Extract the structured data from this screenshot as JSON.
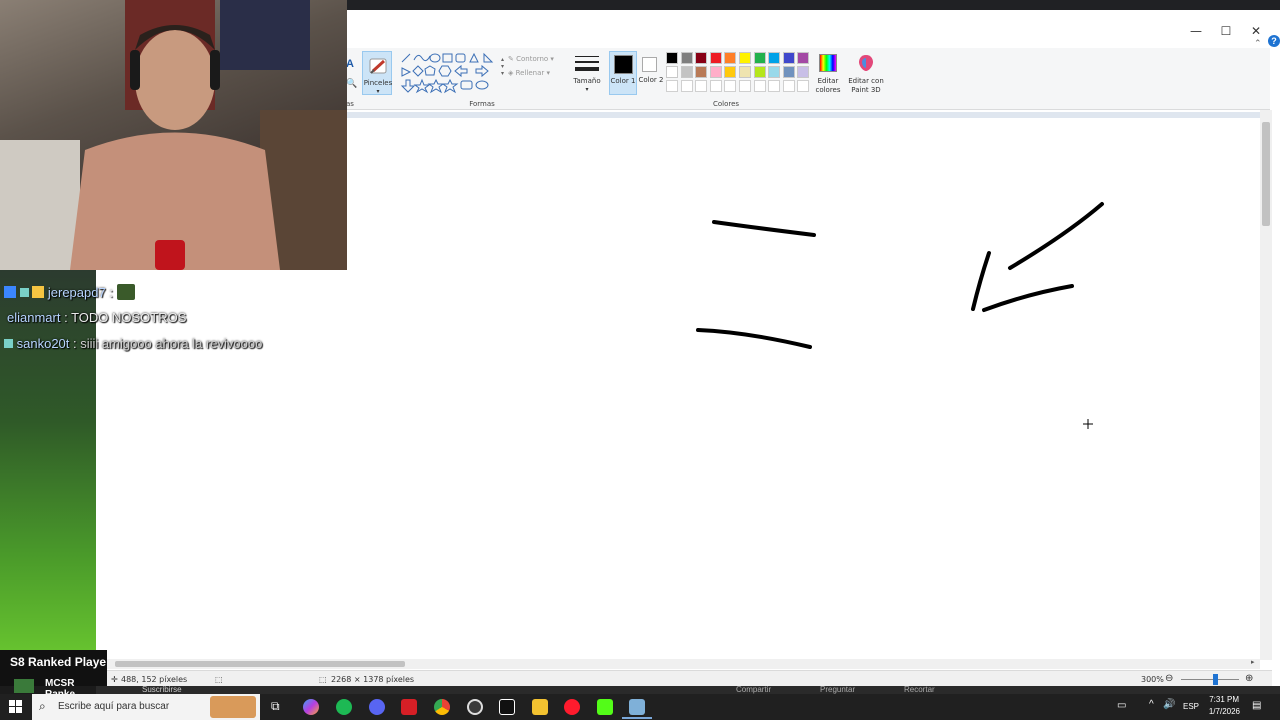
{
  "window": {
    "minimize": "—",
    "maximize": "☐",
    "close": "✕"
  },
  "ribbon": {
    "brushes_label": "Pinceles",
    "shapes_group": "Formas",
    "outline_label": "Contorno",
    "fill_label": "Rellenar",
    "size_label": "Tamaño",
    "color1_label": "Color 1",
    "color2_label": "Color 2",
    "colors_group": "Colores",
    "edit_colors_label": "Editar colores",
    "paint3d_label": "Editar con Paint 3D",
    "truncated_left": "as",
    "palette": [
      "#000000",
      "#7f7f7f",
      "#880015",
      "#ed1c24",
      "#ff7f27",
      "#fff200",
      "#22b14c",
      "#00a2e8",
      "#3f48cc",
      "#a349a4",
      "#ffffff",
      "#c3c3c3",
      "#b97a57",
      "#ffaec9",
      "#ffc90e",
      "#efe4b0",
      "#b5e61d",
      "#99d9ea",
      "#7092be",
      "#c8bfe7"
    ]
  },
  "status": {
    "cursor_pos": "488, 152 píxeles",
    "image_size": "2268 × 1378 píxeles",
    "zoom": "300%"
  },
  "chat": {
    "lines": [
      {
        "name": "jerepapd7",
        "message": ""
      },
      {
        "name": "elianmart",
        "message": "TODO NOSOTROS"
      },
      {
        "name": "sanko20t",
        "message": "siiii amigooo ahora la revivoooo"
      }
    ]
  },
  "overlay": {
    "ranked_text": "S8 Ranked Playe",
    "mcsr_text": "MCSR Ranke",
    "subscribe_text": "Suscribirse"
  },
  "taskbar": {
    "search_placeholder": "Escribe aquí para buscar",
    "language": "ESP",
    "time": "7:31 PM",
    "date": "1/7/2026"
  },
  "app_strip": {
    "compartir": "Compartir",
    "preguntar": "Preguntar",
    "recortar": "Recortar"
  }
}
